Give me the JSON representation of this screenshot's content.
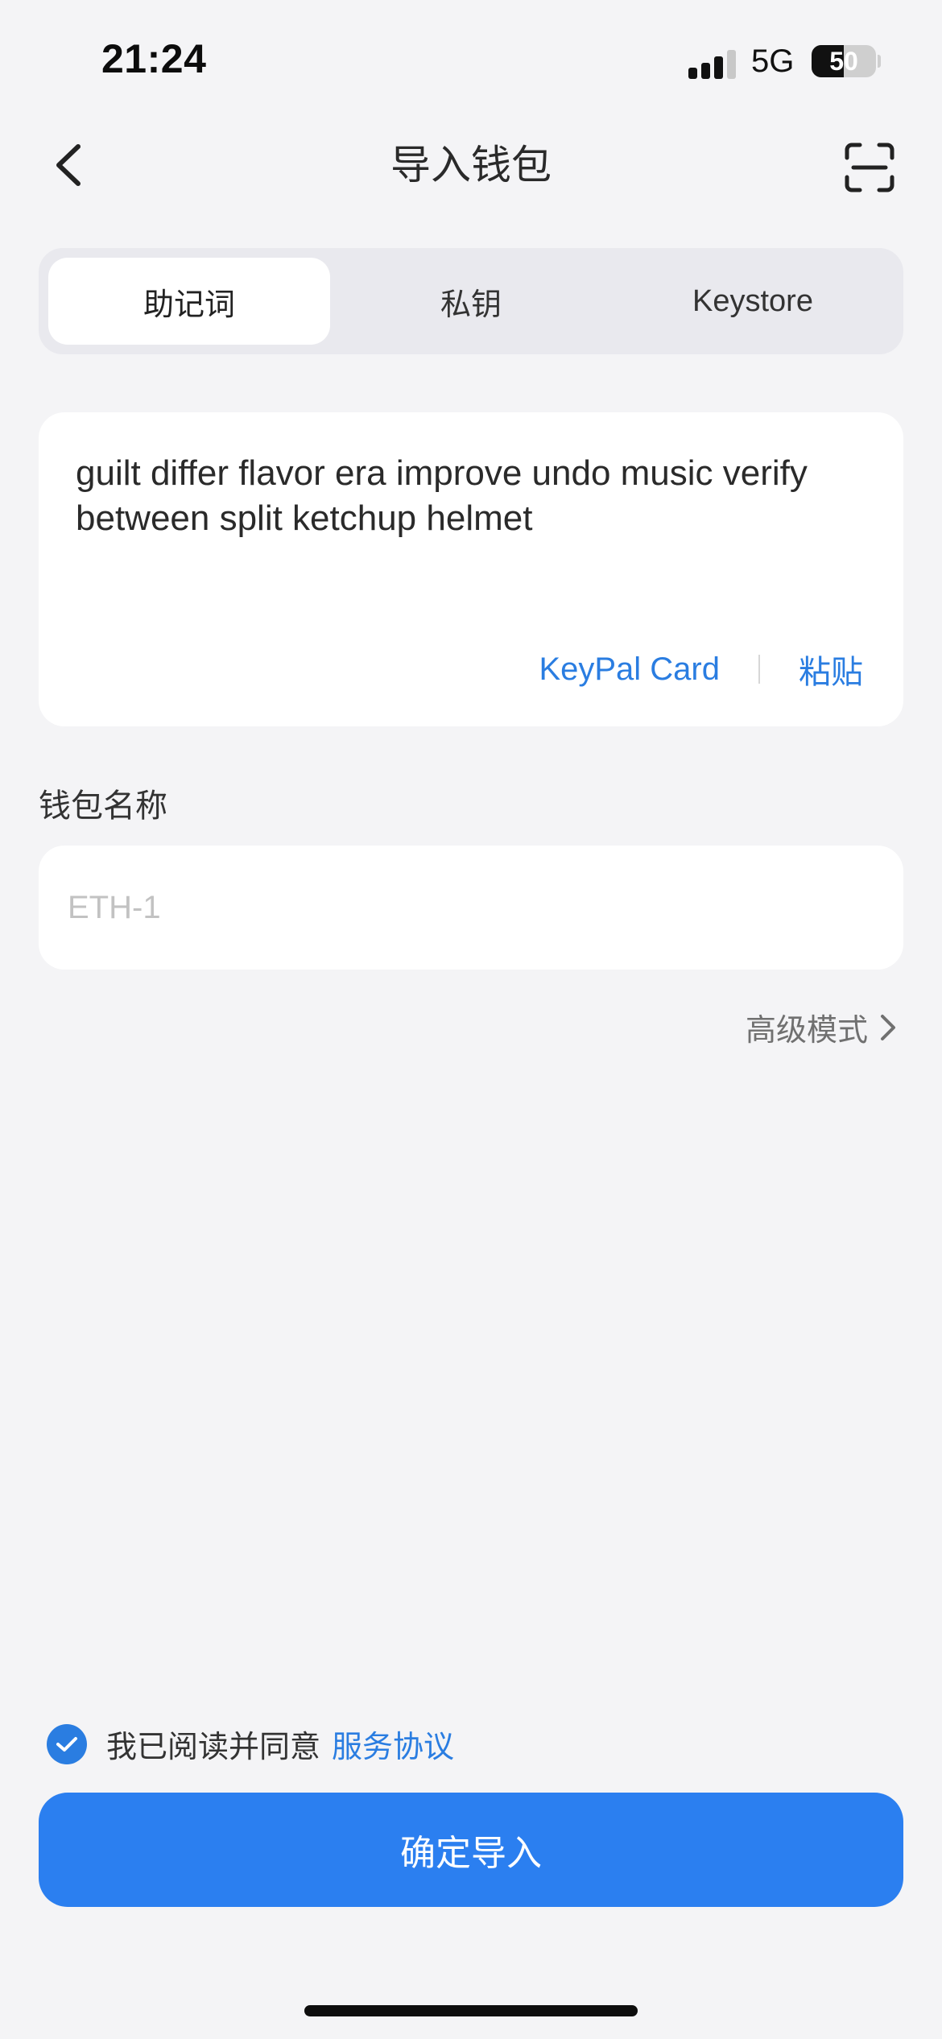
{
  "status_bar": {
    "time": "21:24",
    "network": "5G",
    "battery_pct": "50",
    "battery_level": 0.5,
    "signal_bars_active": 3
  },
  "nav": {
    "title": "导入钱包",
    "back_icon": "chevron-left-icon",
    "scan_icon": "scan-icon"
  },
  "tabs": [
    {
      "label": "助记词",
      "active": true
    },
    {
      "label": "私钥",
      "active": false
    },
    {
      "label": "Keystore",
      "active": false
    }
  ],
  "mnemonic": {
    "value": "guilt differ flavor era improve undo music verify between split ketchup helmet",
    "keypal_label": "KeyPal Card",
    "paste_label": "粘贴"
  },
  "wallet_name": {
    "label": "钱包名称",
    "placeholder": "ETH-1",
    "value": ""
  },
  "advanced": {
    "label": "高级模式"
  },
  "agreement": {
    "text": "我已阅读并同意",
    "link": "服务协议",
    "checked": true
  },
  "confirm_button": {
    "label": "确定导入"
  },
  "colors": {
    "accent": "#2a7de1",
    "button": "#2b7ff0",
    "background": "#f4f4f6"
  }
}
